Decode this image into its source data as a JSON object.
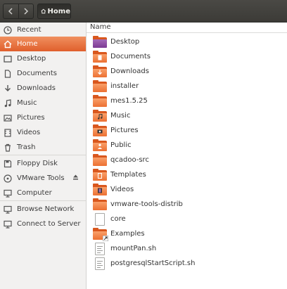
{
  "toolbar": {
    "back_icon": "chevron-left-icon",
    "forward_icon": "chevron-right-icon",
    "breadcrumb": {
      "icon": "home-icon",
      "label": "Home"
    }
  },
  "sidebar": {
    "active_color": "#e9692f",
    "items": [
      {
        "label": "Recent",
        "icon": "recent-icon"
      },
      {
        "label": "Home",
        "icon": "home-icon",
        "active": true
      },
      {
        "label": "Desktop",
        "icon": "desktop-icon"
      },
      {
        "label": "Documents",
        "icon": "documents-icon"
      },
      {
        "label": "Downloads",
        "icon": "downloads-icon"
      },
      {
        "label": "Music",
        "icon": "music-icon"
      },
      {
        "label": "Pictures",
        "icon": "pictures-icon"
      },
      {
        "label": "Videos",
        "icon": "videos-icon"
      },
      {
        "label": "Trash",
        "icon": "trash-icon"
      },
      {
        "label": "Floppy Disk",
        "icon": "floppy-icon"
      },
      {
        "label": "VMware Tools",
        "icon": "disc-icon",
        "eject": true
      },
      {
        "label": "Computer",
        "icon": "computer-icon"
      },
      {
        "label": "Browse Network",
        "icon": "network-icon"
      },
      {
        "label": "Connect to Server",
        "icon": "server-icon"
      }
    ]
  },
  "main": {
    "column_header": "Name",
    "files": [
      {
        "name": "Desktop",
        "type": "folder-desktop"
      },
      {
        "name": "Documents",
        "type": "folder-documents"
      },
      {
        "name": "Downloads",
        "type": "folder-downloads"
      },
      {
        "name": "installer",
        "type": "folder"
      },
      {
        "name": "mes1.5.25",
        "type": "folder"
      },
      {
        "name": "Music",
        "type": "folder-music"
      },
      {
        "name": "Pictures",
        "type": "folder-pictures"
      },
      {
        "name": "Public",
        "type": "folder-public"
      },
      {
        "name": "qcadoo-src",
        "type": "folder"
      },
      {
        "name": "Templates",
        "type": "folder-templates"
      },
      {
        "name": "Videos",
        "type": "folder-videos"
      },
      {
        "name": "vmware-tools-distrib",
        "type": "folder"
      },
      {
        "name": "core",
        "type": "file"
      },
      {
        "name": "Examples",
        "type": "folder-link"
      },
      {
        "name": "mountPan.sh",
        "type": "file-script"
      },
      {
        "name": "postgresqlStartScript.sh",
        "type": "file-script"
      }
    ]
  }
}
